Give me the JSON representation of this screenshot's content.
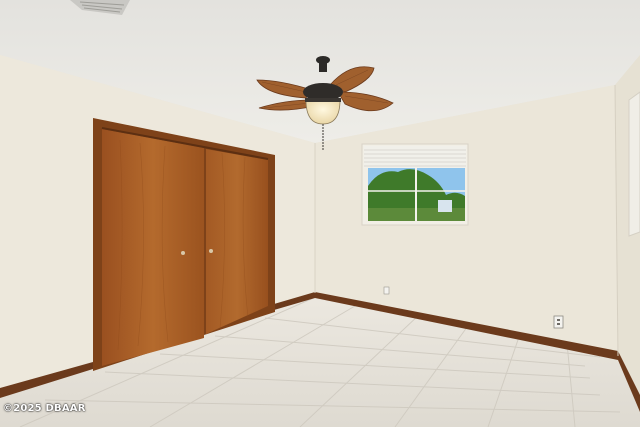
{
  "watermark": {
    "text": "©2025 DBAAR"
  },
  "colors": {
    "ceiling": "#e8e7e2",
    "left_wall": "#ede8dc",
    "back_wall": "#ebe6d9",
    "right_wall": "#e9e4d7",
    "floor": "#e6e2da",
    "baseboard": "#6b3a1c",
    "door_wood": "#a85a22",
    "door_frame": "#7e4219",
    "window_blind": "#f1f0ea",
    "sky": "#8fc4ec",
    "tree": "#3f7a2a",
    "fan_blade": "#a0602e"
  },
  "icons": [
    "ceiling-fan-icon",
    "air-vent-icon",
    "electrical-outlet-icon"
  ]
}
